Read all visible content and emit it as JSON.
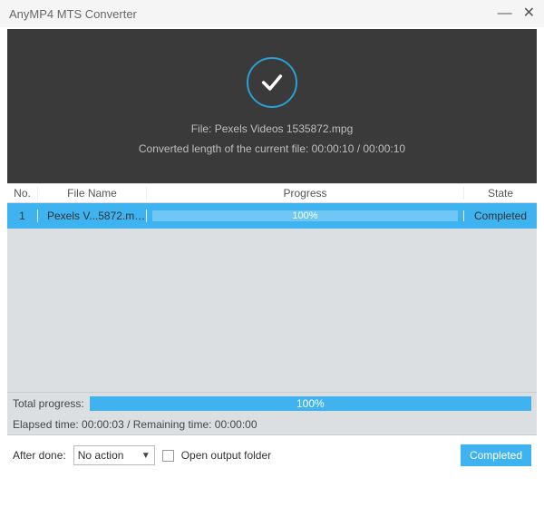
{
  "titlebar": {
    "title": "AnyMP4 MTS Converter"
  },
  "hero": {
    "file_line": "File: Pexels Videos 1535872.mpg",
    "length_line": "Converted length of the current file: 00:00:10 / 00:00:10"
  },
  "table": {
    "headers": {
      "no": "No.",
      "name": "File Name",
      "progress": "Progress",
      "state": "State"
    },
    "rows": [
      {
        "no": "1",
        "name": "Pexels V...5872.mpg",
        "progress_label": "100%",
        "state": "Completed"
      }
    ]
  },
  "total": {
    "label": "Total progress:",
    "percent_label": "100%"
  },
  "time_line": "Elapsed time: 00:00:03 / Remaining time: 00:00:00",
  "actions": {
    "after_done_label": "After done:",
    "after_done_value": "No action",
    "open_folder_label": "Open output folder",
    "completed_button": "Completed"
  }
}
